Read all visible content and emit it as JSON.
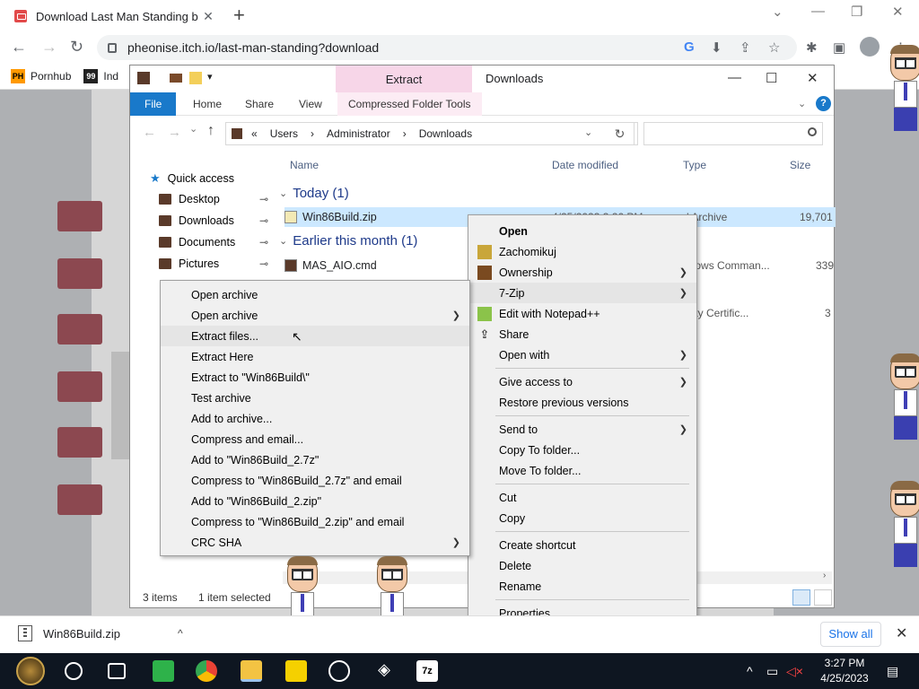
{
  "browser": {
    "tab_title": "Download Last Man Standing b",
    "url": "pheonise.itch.io/last-man-standing?download",
    "bookmarks": [
      {
        "label": "Pornhub",
        "icon": "PH"
      },
      {
        "label": "Ind",
        "icon": "99"
      }
    ]
  },
  "explorer": {
    "extract_tab": "Extract",
    "title": "Downloads",
    "ribbon_tabs": [
      "File",
      "Home",
      "Share",
      "View",
      "Compressed Folder Tools"
    ],
    "breadcrumb": [
      "«",
      "Users",
      "›",
      "Administrator",
      "›",
      "Downloads"
    ],
    "columns": {
      "name": "Name",
      "date": "Date modified",
      "type": "Type",
      "size": "Size"
    },
    "nav": [
      "Quick access",
      "Desktop",
      "Downloads",
      "Documents",
      "Pictures"
    ],
    "groups": [
      {
        "label": "Today (1)"
      },
      {
        "label": "Earlier this month (1)"
      }
    ],
    "files": [
      {
        "name": "Win86Build.zip",
        "date": "4/25/2023 3:26 PM",
        "type": "d Archive",
        "size": "19,701"
      },
      {
        "name": "MAS_AIO.cmd",
        "type": "ndows Comman...",
        "size": "339"
      }
    ],
    "extra_row": {
      "type": "urity Certific...",
      "size": "3"
    },
    "status": {
      "count": "3 items",
      "selected": "1 item selected"
    }
  },
  "menu_7zip": {
    "items": [
      "Open archive",
      "Open archive",
      "Extract files...",
      "Extract Here",
      "Extract to \"Win86Build\\\"",
      "Test archive",
      "Add to archive...",
      "Compress and email...",
      "Add to \"Win86Build_2.7z\"",
      "Compress to \"Win86Build_2.7z\" and email",
      "Add to \"Win86Build_2.zip\"",
      "Compress to \"Win86Build_2.zip\" and email",
      "CRC SHA"
    ]
  },
  "menu_main": {
    "items": [
      "Open",
      "Zachomikuj",
      "Ownership",
      "7-Zip",
      "Edit with Notepad++",
      "Share",
      "Open with",
      "Give access to",
      "Restore previous versions",
      "Send to",
      "Copy To folder...",
      "Move To folder...",
      "Cut",
      "Copy",
      "Create shortcut",
      "Delete",
      "Rename",
      "Properties"
    ]
  },
  "downloads_bar": {
    "file": "Win86Build.zip",
    "show_all": "Show all"
  },
  "taskbar": {
    "time": "3:27 PM",
    "date": "4/25/2023"
  },
  "colors": {
    "accent": "#1979ca",
    "extract_tab": "#f7d6e8",
    "selection": "#cce8ff"
  }
}
